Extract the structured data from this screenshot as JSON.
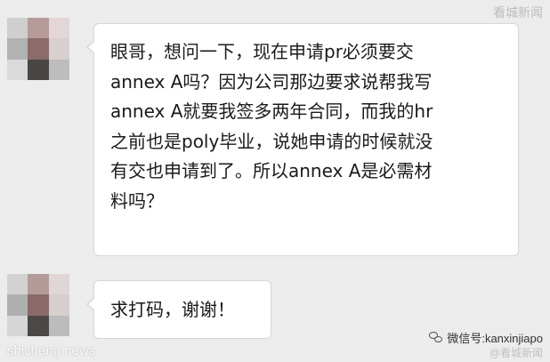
{
  "message_1": {
    "lines": [
      "眼哥，想问一下，现在申请pr必须要交",
      "annex A吗？因为公司那边要求说帮我写",
      "annex A就要我签多两年合同，而我的hr",
      "之前也是poly毕业，说她申请的时候就没",
      "有交也申请到了。所以annex A是必需材",
      "料吗？"
    ]
  },
  "message_2": {
    "text": "求打码，谢谢！"
  },
  "watermarks": {
    "top_right": "看城新闻",
    "bottom_left": "shicheng news",
    "bottom_right": "微信号:kanxinjiapo",
    "bottom_right_sub": "@看城新闻"
  },
  "colors": {
    "background": "#ececec",
    "bubble": "#ffffff",
    "bubble_border": "#d6d6d6",
    "text": "#1a1a1a"
  },
  "icons": {
    "wechat": "wechat-icon"
  }
}
